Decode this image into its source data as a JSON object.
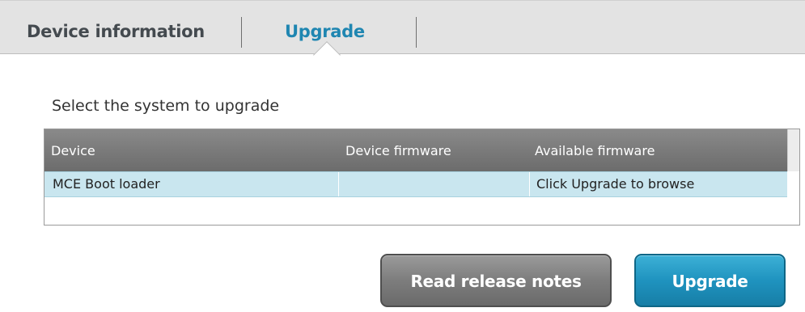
{
  "tabs": [
    {
      "label": "Device information",
      "active": false
    },
    {
      "label": "Upgrade",
      "active": true
    }
  ],
  "section": {
    "title": "Select the system to upgrade"
  },
  "table": {
    "columns": [
      "Device",
      "Device firmware",
      "Available firmware"
    ],
    "rows": [
      {
        "device": "MCE Boot loader",
        "device_firmware": "",
        "available_firmware": "Click Upgrade to browse",
        "selected": true
      }
    ]
  },
  "buttons": {
    "release_notes": "Read release notes",
    "upgrade": "Upgrade"
  },
  "colors": {
    "accent": "#1f86b1",
    "tab_inactive": "#444a4f",
    "header_bg": "#7c7c7c",
    "row_selected": "#c9e6ef",
    "button_primary": "#1f93bf",
    "button_secondary": "#7d7d7d"
  }
}
